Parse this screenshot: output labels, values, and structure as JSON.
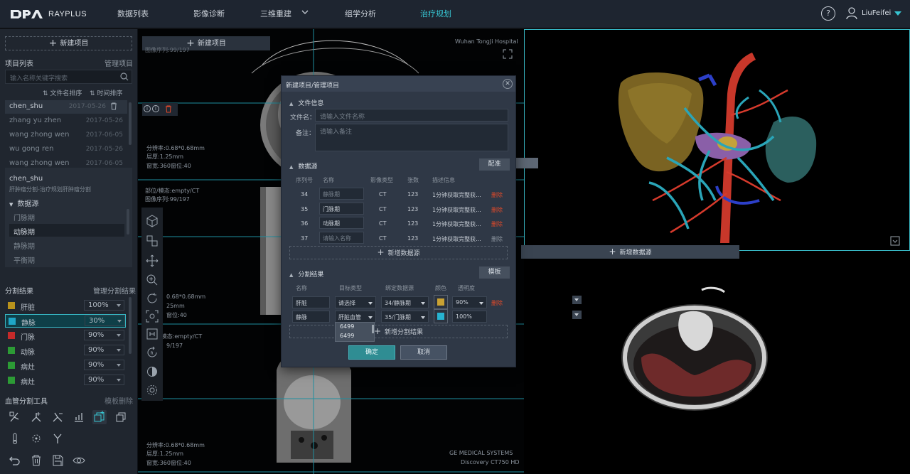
{
  "brand": {
    "name": "RAYPLUS"
  },
  "nav": {
    "items": [
      "数据列表",
      "影像诊断",
      "三维重建",
      "组学分析",
      "治疗规划"
    ],
    "active": "治疗规划",
    "user": "LiuFeifei"
  },
  "sidebar": {
    "new_project": "新建项目",
    "project_list_title": "项目列表",
    "manage_projects": "管理项目",
    "search_placeholder": "输入名称关键字搜索",
    "sort_by_name": "文件名排序",
    "sort_by_time": "时间排序",
    "projects": [
      {
        "name": "chen_shu",
        "date": "2017-05-26"
      },
      {
        "name": "zhang yu zhen",
        "date": "2017-05-26"
      },
      {
        "name": "wang zhong wen",
        "date": "2017-06-05"
      },
      {
        "name": "wu gong ren",
        "date": "2017-05-26"
      },
      {
        "name": "wang zhong wen",
        "date": "2017-06-05"
      }
    ],
    "detail": {
      "name": "chen_shu",
      "description": "肝肿瘤分割-治疗规划肝肿瘤分割",
      "datasource_title": "数据源",
      "datasources": [
        "门脉期",
        "动脉期",
        "静脉期",
        "平衡期"
      ]
    },
    "segmentation_title": "分割结果",
    "manage_segmentation": "管理分割结果",
    "segments": [
      {
        "name": "肝脏",
        "opacity": "100%",
        "color": "#b8921c"
      },
      {
        "name": "静脉",
        "opacity": "30%",
        "color": "#1fa6c7"
      },
      {
        "name": "门脉",
        "opacity": "90%",
        "color": "#c42a2a"
      },
      {
        "name": "动脉",
        "opacity": "90%",
        "color": "#2c9b35"
      },
      {
        "name": "病灶",
        "opacity": "90%",
        "color": "#2c9b35"
      },
      {
        "name": "病灶",
        "opacity": "90%",
        "color": "#2c9b35"
      }
    ],
    "vessel_tools_title": "血管分割工具",
    "vessel_tools_delete": "模板删除"
  },
  "viewer": {
    "new_project_overlay": "新建项目",
    "hospital": "Wuhan TongJi Hospital",
    "series_top": "图像序列:99/197",
    "res_info": "分辨率:0.68*0.68mm",
    "thickness": "层厚:1.25mm",
    "window": "窗宽:360窗位:40",
    "mid_info1": "部位/模态:empty/CT",
    "mid_info2": "图像序列:99/197",
    "res_info_short": "0.68*0.68mm",
    "thickness_short": "25mm",
    "window_short": "窗位:40",
    "lower_info1": "部位/模态:empty/CT",
    "lower_info2": "图像序列:99/197",
    "lower_series": "9/197",
    "bottom_res": "分辨率:0.68*0.68mm",
    "bottom_thick": "层厚:1.25mm",
    "bottom_window": "窗宽:360窗位:40",
    "ge": "GE MEDICAL SYSTEMS",
    "discovery": "Discovery CT750 HD"
  },
  "modal": {
    "title": "新建项目/管理项目",
    "file_info": "文件信息",
    "file_name_label": "文件名：",
    "file_name_placeholder": "请输入文件名称",
    "note_label": "备注：",
    "note_placeholder": "请输入备注",
    "datasource_title": "数据源",
    "config_btn": "配准",
    "ds_headers": [
      "序列号",
      "名称",
      "影像类型",
      "张数",
      "描述信息"
    ],
    "ds_rows": [
      {
        "seq": "34",
        "name": "静脉期",
        "type": "CT",
        "count": "123",
        "desc": "1分钟获取完整获...",
        "action": "删除"
      },
      {
        "seq": "35",
        "name": "门脉期",
        "type": "CT",
        "count": "123",
        "desc": "1分钟获取完整获...",
        "action": "删除"
      },
      {
        "seq": "36",
        "name": "动脉期",
        "type": "CT",
        "count": "123",
        "desc": "1分钟获取完整获...",
        "action": "删除"
      },
      {
        "seq": "37",
        "name": "请输入名称",
        "type": "CT",
        "count": "123",
        "desc": "1分钟获取完整获...",
        "action": "删除"
      }
    ],
    "add_datasource": "新增数据源",
    "seg_title": "分割结果",
    "template_btn": "模板",
    "seg_headers": [
      "名称",
      "目标类型",
      "绑定数据源",
      "颜色",
      "透明度"
    ],
    "seg_rows": [
      {
        "name": "肝脏",
        "target": "请选择",
        "source": "34/静脉期",
        "color": "#c9a233",
        "opacity": "90%",
        "action": "删除"
      },
      {
        "name": "静脉",
        "target": "肝脏血管",
        "source": "35/门脉期",
        "color": "#27b3d1",
        "opacity": "100%"
      }
    ],
    "add_seg": "新增分割结果",
    "dropdown_items": [
      "6499",
      "6499"
    ],
    "ok": "确定",
    "cancel": "取消"
  },
  "float_add_datasource": "新增数据源"
}
